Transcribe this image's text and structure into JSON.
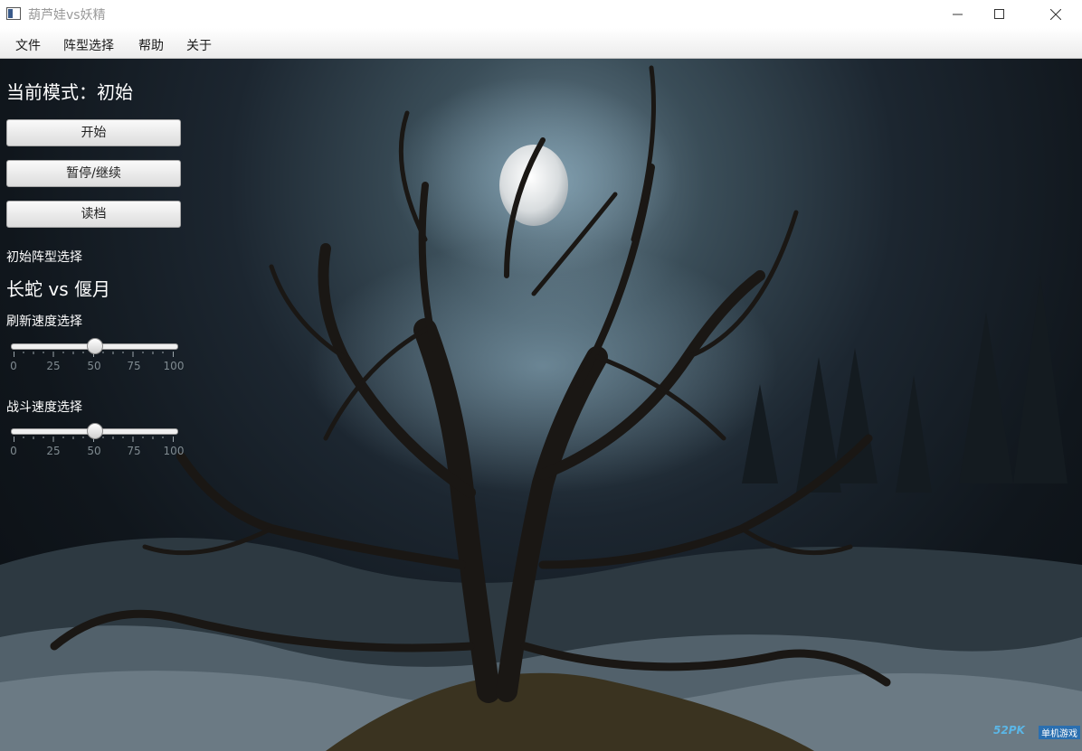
{
  "window": {
    "title": "葫芦娃vs妖精"
  },
  "menu": {
    "items": [
      "文件",
      "阵型选择",
      "帮助",
      "关于"
    ]
  },
  "status": {
    "mode_label": "当前模式：初始"
  },
  "buttons": {
    "start": "开始",
    "pause_resume": "暂停/继续",
    "load": "读档"
  },
  "formation": {
    "label": "初始阵型选择",
    "value": "长蛇 vs 偃月"
  },
  "refresh_speed": {
    "label": "刷新速度选择",
    "value": 50,
    "ticks": [
      "0",
      "25",
      "50",
      "75",
      "100"
    ]
  },
  "battle_speed": {
    "label": "战斗速度选择",
    "value": 50,
    "ticks": [
      "0",
      "25",
      "50",
      "75",
      "100"
    ]
  },
  "watermark": {
    "logo": "52PK",
    "caption": "单机游戏"
  }
}
